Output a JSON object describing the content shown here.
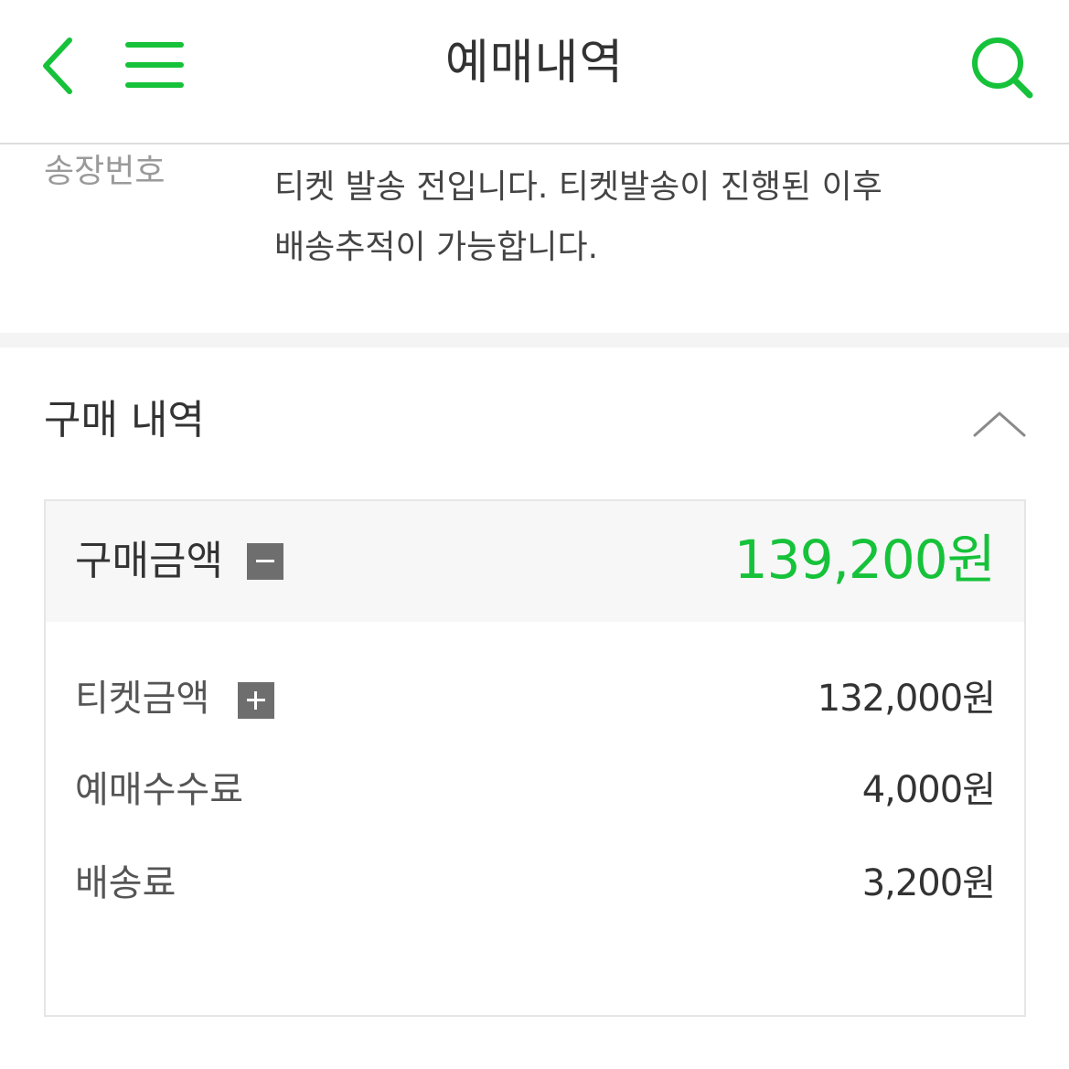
{
  "header": {
    "title": "예매내역",
    "back_icon": "chevron-left-icon",
    "menu_icon": "hamburger-menu-icon",
    "search_icon": "search-icon",
    "accent_color": "#16c23a"
  },
  "tracking": {
    "label": "송장번호",
    "message": "티켓 발송 전입니다. 티켓발송이 진행된 이후 배송추적이 가능합니다."
  },
  "purchase": {
    "title": "구매 내역",
    "collapse_icon": "chevron-up-icon",
    "total": {
      "label": "구매금액",
      "toggle_icon": "minus-square-icon",
      "value": "139,200원"
    },
    "rows": [
      {
        "label": "티켓금액",
        "value": "132,000원",
        "toggle_icon": "plus-square-icon"
      },
      {
        "label": "예매수수료",
        "value": "4,000원"
      },
      {
        "label": "배송료",
        "value": "3,200원"
      }
    ]
  }
}
